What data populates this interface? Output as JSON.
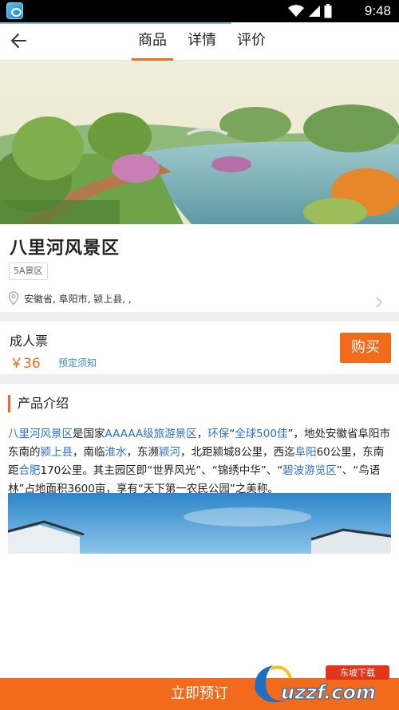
{
  "status_bar": {
    "time": "9:48",
    "icons": [
      "app-icon",
      "wifi-icon",
      "signal-icon",
      "battery-icon"
    ]
  },
  "header": {
    "tabs": [
      {
        "label": "商品",
        "active": true
      },
      {
        "label": "详情",
        "active": false
      },
      {
        "label": "评价",
        "active": false
      }
    ]
  },
  "scenic": {
    "title": "八里河风景区",
    "level": "5A景区",
    "address": "安徽省, 阜阳市, 颍上县, ,"
  },
  "ticket": {
    "name": "成人票",
    "price": "￥36",
    "notice": "预定须知",
    "buy_label": "购买"
  },
  "intro": {
    "heading": "产品介绍",
    "segments": [
      {
        "t": "八里河风景区",
        "hl": true
      },
      {
        "t": "是国家",
        "hl": false
      },
      {
        "t": "AAAAA级旅游景区",
        "hl": true
      },
      {
        "t": "，",
        "hl": false
      },
      {
        "t": "环保",
        "hl": true
      },
      {
        "t": "“",
        "hl": false
      },
      {
        "t": "全球500佳",
        "hl": true
      },
      {
        "t": "”，地处安徽省阜阳市东南的",
        "hl": false
      },
      {
        "t": "颍上县",
        "hl": true
      },
      {
        "t": "，南临",
        "hl": false
      },
      {
        "t": "淮水",
        "hl": true
      },
      {
        "t": "，东濒",
        "hl": false
      },
      {
        "t": "颍河",
        "hl": true
      },
      {
        "t": "，北距颍城8公里，西迄",
        "hl": false
      },
      {
        "t": "阜阳",
        "hl": true
      },
      {
        "t": "60公里，东南距",
        "hl": false
      },
      {
        "t": "合肥",
        "hl": true
      },
      {
        "t": "170公里。其主园区即“世界风光”、“锦绣中华”、“",
        "hl": false
      },
      {
        "t": "碧波游览区",
        "hl": true
      },
      {
        "t": "”、“鸟语林”占地面积3600亩，享有“天下第一农民公园”之美称。",
        "hl": false
      }
    ]
  },
  "bottom_bar": {
    "label": "立即预订"
  },
  "watermark": {
    "text": "uzzf.com",
    "tag": "东坡下载"
  },
  "colors": {
    "accent": "#f26a1b",
    "link": "#3a8ed6",
    "highlight": "#2f6fcf",
    "divider": "#efefef"
  }
}
